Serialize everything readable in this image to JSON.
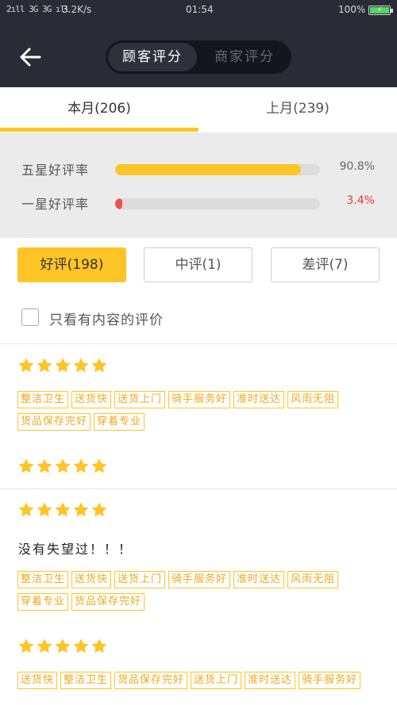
{
  "status_bar": {
    "signal": "2ıll 3G 3G ıll",
    "speed": "3.2K/s",
    "time": "01:54",
    "battery": "100%"
  },
  "header": {
    "segments": [
      "顾客评分",
      "商家评分"
    ],
    "active_segment": 0
  },
  "tabs": [
    {
      "label": "本月(206)"
    },
    {
      "label": "上月(239)"
    }
  ],
  "stats": [
    {
      "label": "五星好评率",
      "value": "90.8%",
      "percent": 90.8,
      "bar_color": "#ffc425",
      "value_color": "#666666"
    },
    {
      "label": "一星好评率",
      "value": "3.4%",
      "percent": 3.4,
      "bar_color": "#f05050",
      "value_color": "#e53935"
    }
  ],
  "filters": {
    "buttons": [
      {
        "label": "好评(198)",
        "active": true
      },
      {
        "label": "中评(1)",
        "active": false
      },
      {
        "label": "差评(7)",
        "active": false
      }
    ],
    "checkbox_label": "只看有内容的评价"
  },
  "reviews": [
    {
      "stars": 5,
      "text": "",
      "tags": [
        "整洁卫生",
        "送货快",
        "送货上门",
        "骑手服务好",
        "准时送达",
        "风雨无阻",
        "货品保存完好",
        "穿着专业"
      ]
    },
    {
      "stars": 5,
      "text": "",
      "tags": []
    },
    {
      "stars": 5,
      "text": "没有失望过！！！",
      "tags": [
        "整洁卫生",
        "送货快",
        "送货上门",
        "骑手服务好",
        "准时送达",
        "风雨无阻",
        "穿着专业",
        "货品保存完好"
      ]
    },
    {
      "stars": 5,
      "text": "",
      "tags": [
        "送货快",
        "整洁卫生",
        "货品保存完好",
        "送货上门",
        "准时送达",
        "骑手服务好"
      ]
    }
  ],
  "colors": {
    "accent": "#ffc425",
    "header_bg": "#2a2c35"
  }
}
